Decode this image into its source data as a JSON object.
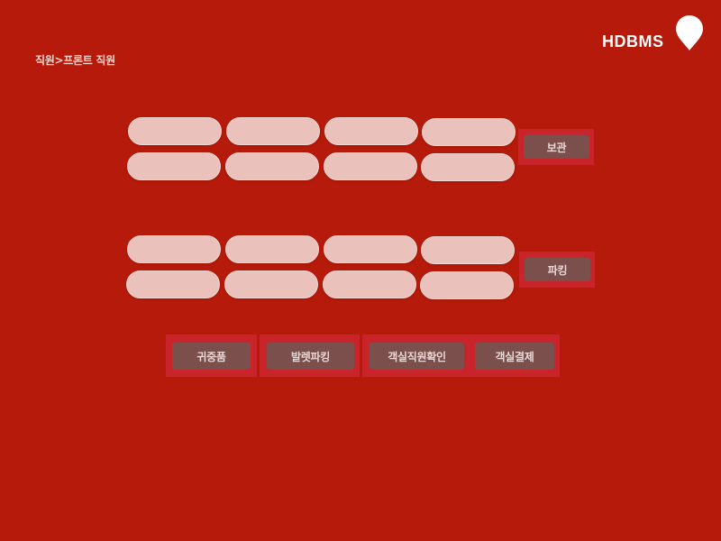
{
  "breadcrumb": "직원>프론트 직원",
  "brand": {
    "name": "HDBMS",
    "logo_icon": "map-pin-icon"
  },
  "storage_section": {
    "fields": [
      "",
      "",
      "",
      "",
      "",
      "",
      "",
      ""
    ],
    "button_label": "보관"
  },
  "parking_section": {
    "fields": [
      "",
      "",
      "",
      "",
      "",
      "",
      "",
      ""
    ],
    "button_label": "파킹"
  },
  "bottom_buttons": {
    "valuables": "귀중품",
    "valet_parking": "발렛파킹",
    "room_staff_check": "객실직원확인",
    "room_payment": "객실결제"
  },
  "colors": {
    "background": "#b51a0a",
    "pill": "#ebc1bc",
    "button": "#7a4f4c",
    "button_frame": "#c8242a"
  }
}
